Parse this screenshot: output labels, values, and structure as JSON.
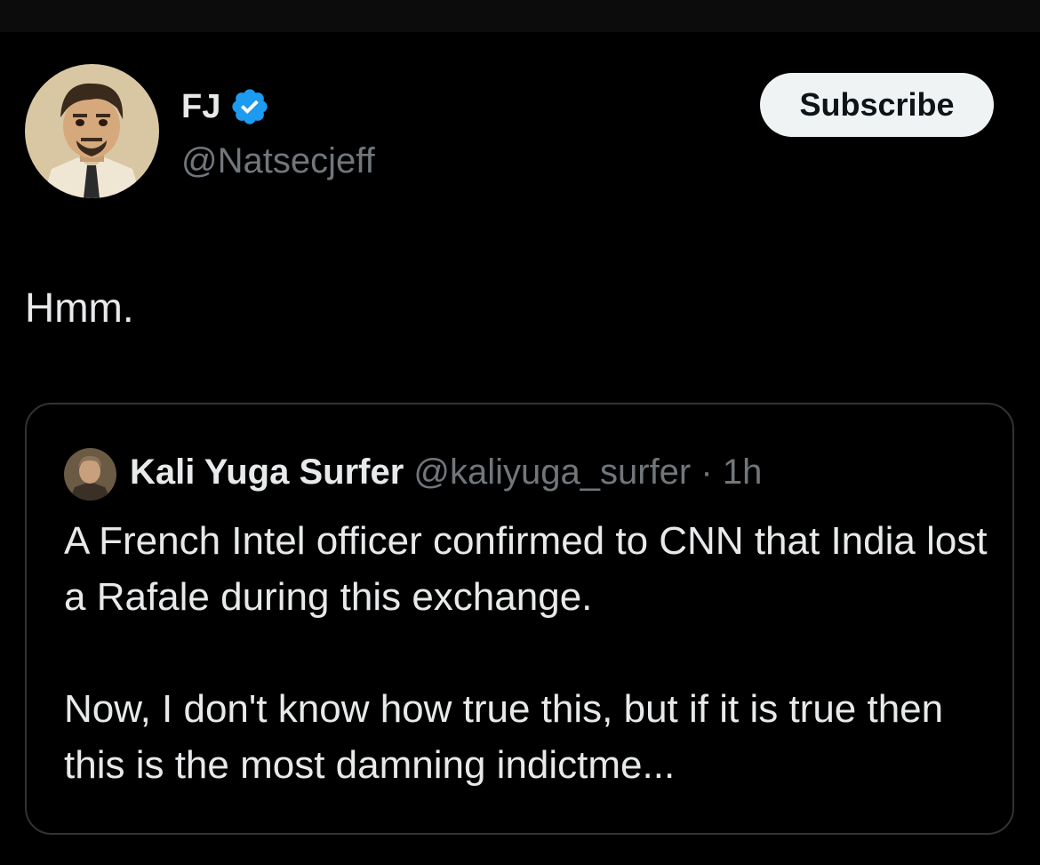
{
  "author": {
    "display_name": "FJ",
    "handle": "@Natsecjeff",
    "verified": true,
    "verified_color": "#1d9bf0"
  },
  "actions": {
    "subscribe_label": "Subscribe"
  },
  "tweet": {
    "text": "Hmm."
  },
  "quoted_tweet": {
    "display_name": "Kali Yuga Surfer",
    "handle": "@kaliyuga_surfer",
    "separator": "·",
    "time": "1h",
    "paragraph_1": "A French Intel officer confirmed to CNN that India lost a Rafale during this exchange.",
    "paragraph_2": "Now, I don't know how true this, but if it is true then this is the most damning indictme..."
  },
  "icons": {
    "verified": "verified-badge-icon",
    "avatar": "cartoon-man-avatar",
    "quote_avatar": "man-photo-avatar"
  }
}
